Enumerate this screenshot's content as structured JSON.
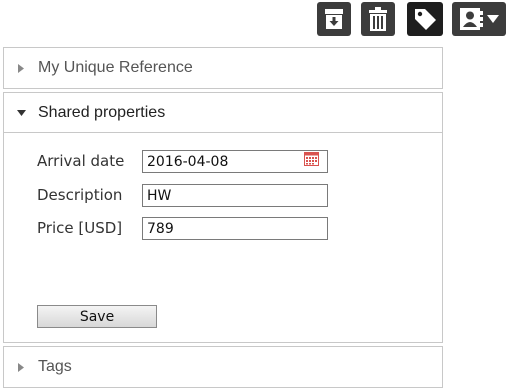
{
  "toolbar": {
    "buttons": [
      {
        "icon": "archive-download-icon"
      },
      {
        "icon": "trash-icon"
      },
      {
        "icon": "tag-icon"
      },
      {
        "icon": "contact-card-icon"
      }
    ],
    "colors": {
      "button_bg": "#3c3c3c",
      "active_bg": "#1e1e1e",
      "icon": "#ffffff"
    }
  },
  "panels": {
    "reference": {
      "title": "My Unique Reference",
      "state": "collapsed"
    },
    "shared": {
      "title": "Shared properties",
      "state": "expanded",
      "fields": {
        "arrival_date": {
          "label": "Arrival date",
          "value": "2016-04-08"
        },
        "description": {
          "label": "Description",
          "value": "HW"
        },
        "price": {
          "label": "Price [USD]",
          "value": "789"
        }
      },
      "save_label": "Save"
    },
    "tags": {
      "title": "Tags",
      "state": "collapsed"
    }
  },
  "colors": {
    "border": "#c8c8c8",
    "calendar_accent": "#d9534f"
  }
}
